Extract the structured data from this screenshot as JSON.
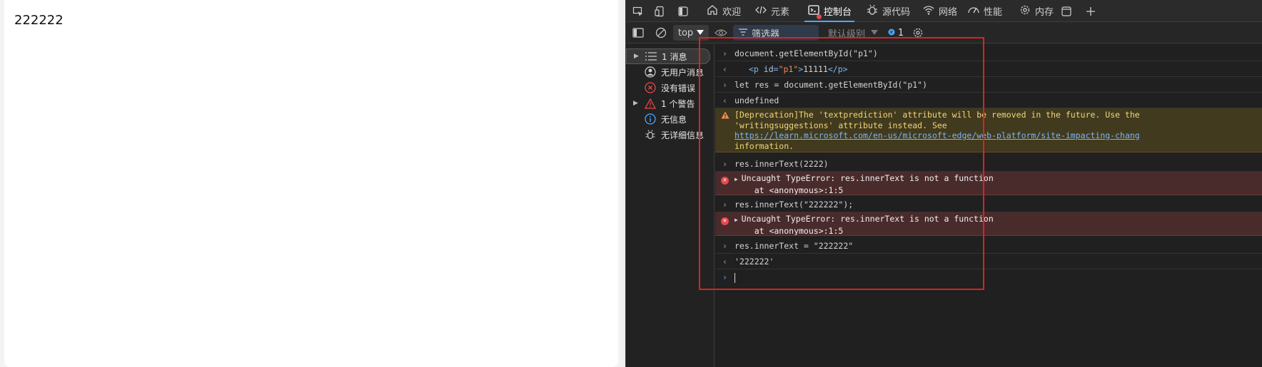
{
  "page": {
    "content_text": "222222"
  },
  "devtools": {
    "tabs": [
      {
        "label": "欢迎",
        "icon": "home-icon"
      },
      {
        "label": "元素",
        "icon": "code-icon"
      },
      {
        "label": "控制台",
        "icon": "console-icon",
        "active": true
      },
      {
        "label": "源代码",
        "icon": "bug-icon"
      },
      {
        "label": "网络",
        "icon": "wifi-icon"
      },
      {
        "label": "性能",
        "icon": "gauge-icon"
      },
      {
        "label": "内存",
        "icon": "gear-icon"
      }
    ],
    "toolbar": {
      "context": "top",
      "filter_placeholder": "筛选器",
      "level": "默认级别",
      "issues_count": "1"
    },
    "sidebar": [
      {
        "label": "1 消息",
        "icon": "list-icon",
        "expandable": true
      },
      {
        "label": "无用户消息",
        "icon": "user-icon"
      },
      {
        "label": "没有错误",
        "icon": "error-icon"
      },
      {
        "label": "1 个警告",
        "icon": "warning-icon",
        "expandable": true
      },
      {
        "label": "无信息",
        "icon": "info-icon"
      },
      {
        "label": "无详细信息",
        "icon": "bug-icon"
      }
    ],
    "console": {
      "line1": "document.getElementById(\"p1\")",
      "line2_tag_open": "<p ",
      "line2_attr": "id",
      "line2_eq": "=",
      "line2_val": "\"p1\"",
      "line2_close": ">",
      "line2_text": "11111",
      "line2_end": "</p>",
      "line3": "let res = document.getElementById(\"p1\")",
      "line4": "undefined",
      "warn_line1": "[Deprecation]The 'textprediction' attribute will be removed in the future. Use the",
      "warn_line2": "'writingsuggestions' attribute instead. See",
      "warn_link": "https://learn.microsoft.com/en-us/microsoft-edge/web-platform/site-impacting-chang",
      "warn_line4": "information.",
      "line6": "res.innerText(2222)",
      "err1_line1": "Uncaught TypeError: res.innerText is not a function",
      "err1_line2": "    at <anonymous>:1:5",
      "line8": "res.innerText(\"222222\");",
      "err2_line1": "Uncaught TypeError: res.innerText is not a function",
      "err2_line2": "    at <anonymous>:1:5",
      "line10": "res.innerText = \"222222\"",
      "line11": "'222222'"
    },
    "colors": {
      "accent": "#4aa8ff",
      "error": "#e5484d",
      "warning": "#f2d67a",
      "highlight_box": "#e02020"
    }
  }
}
